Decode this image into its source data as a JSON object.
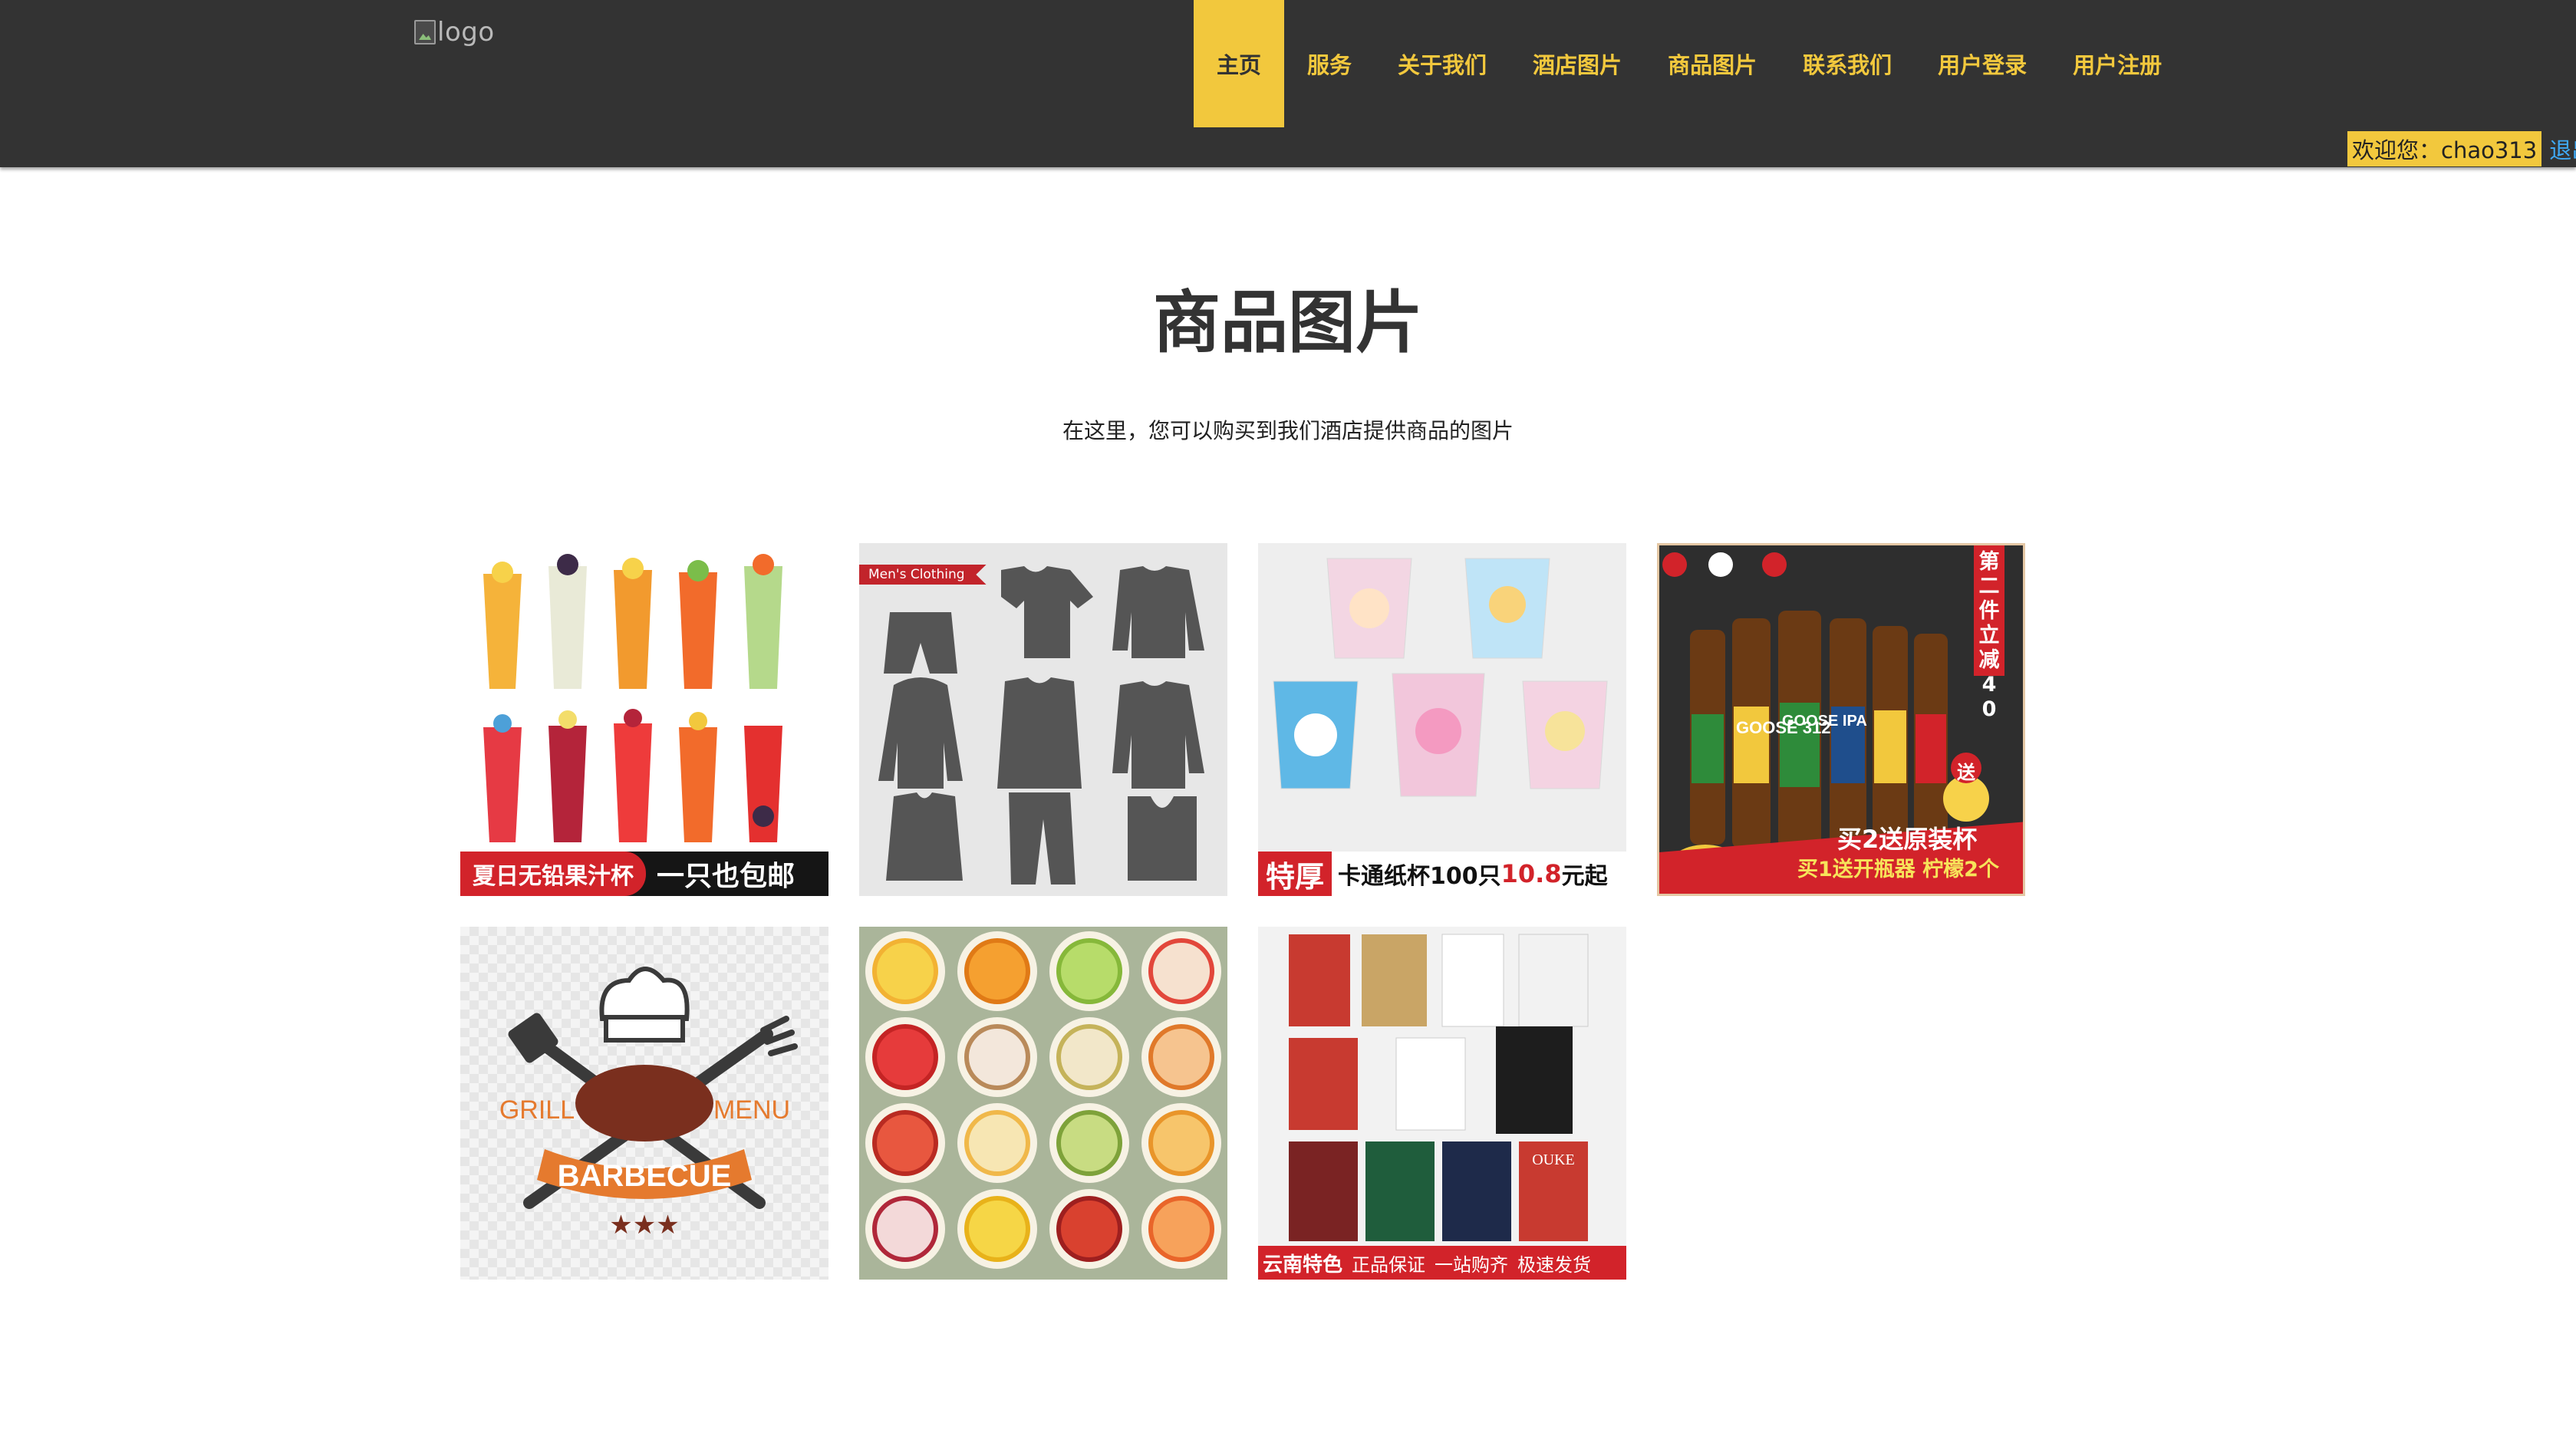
{
  "header": {
    "logo_alt": "logo",
    "nav": [
      {
        "label": "主页",
        "active": true
      },
      {
        "label": "服务",
        "active": false
      },
      {
        "label": "关于我们",
        "active": false
      },
      {
        "label": "酒店图片",
        "active": false
      },
      {
        "label": "商品图片",
        "active": false
      },
      {
        "label": "联系我们",
        "active": false
      },
      {
        "label": "用户登录",
        "active": false
      },
      {
        "label": "用户注册",
        "active": false
      }
    ],
    "welcome": "欢迎您：chao313",
    "logout": "退出"
  },
  "main": {
    "title": "商品图片",
    "subtitle": "在这里，您可以购买到我们酒店提供商品的图片"
  },
  "products": [
    {
      "name": "juice-cups",
      "banner_left": "夏日无铅果汁杯",
      "banner_right": "一只也包邮"
    },
    {
      "name": "mens-clothing",
      "tag": "Men's Clothing"
    },
    {
      "name": "cartoon-paper-cups",
      "banner_tag": "特厚",
      "banner_text": "卡通纸杯100只",
      "banner_price": "10.8",
      "banner_suffix": "元起"
    },
    {
      "name": "craft-beer",
      "side_text": "第二件立减40",
      "promo1": "买2送原装杯",
      "promo2": "买1送开瓶器 柠檬2个",
      "gift": "送",
      "bottle_labels": [
        "GOOSE 312",
        "GOOSE IPA"
      ]
    },
    {
      "name": "barbecue-logo",
      "word_left": "GRILL",
      "word_right": "MENU",
      "ribbon": "BARBECUE"
    },
    {
      "name": "fruit-slices"
    },
    {
      "name": "yunnan-cigarettes",
      "banner_left": "云南特色",
      "banner_items": [
        "正品保证",
        "一站购齐",
        "极速发货"
      ],
      "pack_text": "OUKE"
    }
  ],
  "colors": {
    "header_bg": "#333333",
    "accent": "#f2c83d",
    "link": "#3fa9f5",
    "title": "#333333"
  }
}
